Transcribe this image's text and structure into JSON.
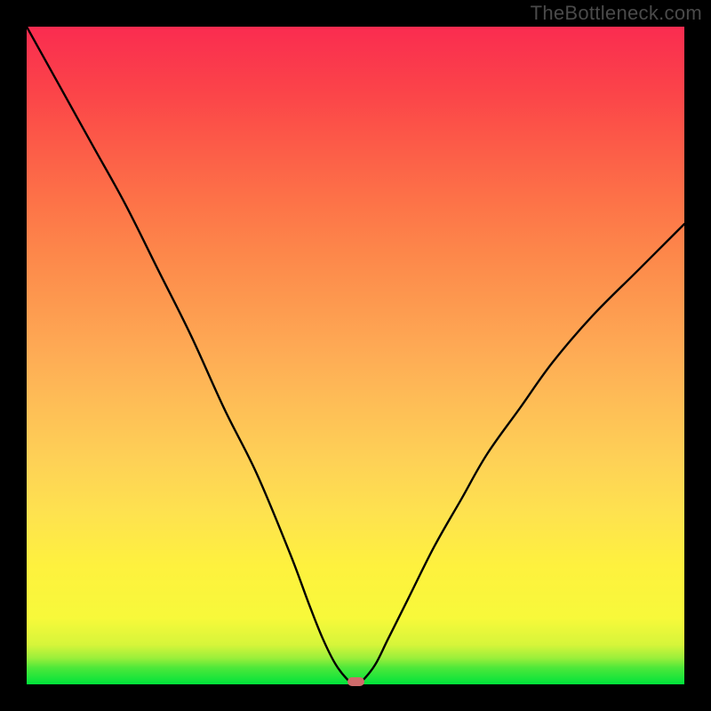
{
  "watermark": "TheBottleneck.com",
  "chart_data": {
    "type": "line",
    "title": "",
    "xlabel": "",
    "ylabel": "",
    "xlim": [
      0,
      100
    ],
    "ylim": [
      0,
      100
    ],
    "grid": false,
    "legend": false,
    "background": "rainbow-gradient-red-to-green",
    "series": [
      {
        "name": "bottleneck-curve",
        "x": [
          0,
          5,
          10,
          15,
          20,
          25,
          30,
          35,
          40,
          43,
          45,
          47,
          49,
          50,
          51,
          53,
          55,
          58,
          62,
          66,
          70,
          75,
          80,
          86,
          93,
          100
        ],
        "y": [
          100,
          91,
          82,
          73,
          63,
          53,
          42,
          32,
          20,
          12,
          7,
          3,
          0.5,
          0,
          0.5,
          3,
          7,
          13,
          21,
          28,
          35,
          42,
          49,
          56,
          63,
          70
        ]
      }
    ],
    "marker": {
      "x_percent": 50,
      "color": "#cf6b6b"
    }
  }
}
